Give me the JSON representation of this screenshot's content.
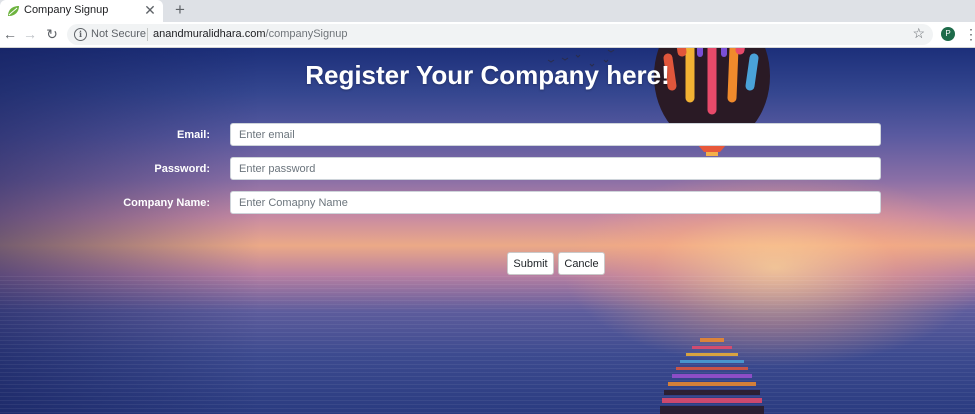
{
  "browser": {
    "tab_title": "Company Signup",
    "tab_close": "✕",
    "new_tab": "+",
    "security_label": "Not Secure",
    "url_host": "anandmuralidhara.com",
    "url_path": "/companySignup",
    "profile_initial": "P"
  },
  "page": {
    "title": "Register Your Company here!",
    "form": {
      "email_label": "Email:",
      "email_placeholder": "Enter email",
      "email_value": "",
      "password_label": "Password:",
      "password_placeholder": "Enter password",
      "password_value": "",
      "company_label": "Company Name:",
      "company_placeholder": "Enter Comapny Name",
      "company_value": "",
      "submit_label": "Submit",
      "cancel_label": "Cancle"
    }
  },
  "icons": {
    "back": "arrow-left-icon",
    "forward": "arrow-right-icon",
    "reload": "reload-icon",
    "info": "info-icon",
    "bookmark": "star-icon",
    "menu": "kebab-menu-icon"
  },
  "colors": {
    "title_text": "#ffffff",
    "profile_bg": "#1e6b4a"
  }
}
